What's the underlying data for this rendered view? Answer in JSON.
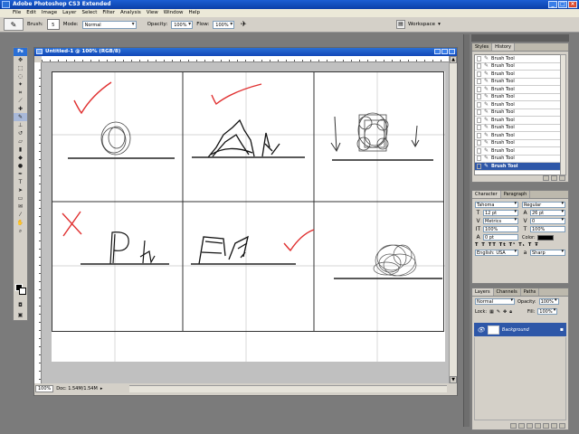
{
  "window": {
    "title": "Adobe Photoshop CS3 Extended"
  },
  "menu": [
    "File",
    "Edit",
    "Image",
    "Layer",
    "Select",
    "Filter",
    "Analysis",
    "View",
    "Window",
    "Help"
  ],
  "options": {
    "brush_label": "Brush:",
    "brush_size": "5",
    "mode_label": "Mode:",
    "mode_value": "Normal",
    "opacity_label": "Opacity:",
    "opacity_value": "100%",
    "flow_label": "Flow:",
    "flow_value": "100%",
    "workspace_label": "Workspace"
  },
  "document": {
    "title": "Untitled-1 @ 100% (RGB/8)",
    "zoom": "100%",
    "doc_size": "Doc: 1.54M/1.54M"
  },
  "history": {
    "tabs": [
      "Styles",
      "History"
    ],
    "items": [
      "Brush Tool",
      "Brush Tool",
      "Brush Tool",
      "Brush Tool",
      "Brush Tool",
      "Brush Tool",
      "Brush Tool",
      "Brush Tool",
      "Brush Tool",
      "Brush Tool",
      "Brush Tool",
      "Brush Tool",
      "Brush Tool",
      "Brush Tool",
      "Brush Tool"
    ],
    "selected_index": 14
  },
  "character": {
    "tabs": [
      "Character",
      "Paragraph"
    ],
    "font_family": "Tahoma",
    "font_style": "Regular",
    "font_size": "12 pt",
    "leading": "26 pt",
    "kerning": "Metrics",
    "tracking": "0",
    "vscale": "100%",
    "hscale": "100%",
    "baseline": "0 pt",
    "color_label": "Color:",
    "language": "English: USA",
    "antialias": "Sharp"
  },
  "layers": {
    "tabs": [
      "Layers",
      "Channels",
      "Paths"
    ],
    "blend_mode": "Normal",
    "opacity_label": "Opacity:",
    "opacity_value": "100%",
    "lock_label": "Lock:",
    "fill_label": "Fill:",
    "fill_value": "100%",
    "layer_name": "Background"
  },
  "colors": {
    "accent": "#2e57a8",
    "title_blue": "#0b3fa8",
    "check_red": "#e03030"
  }
}
